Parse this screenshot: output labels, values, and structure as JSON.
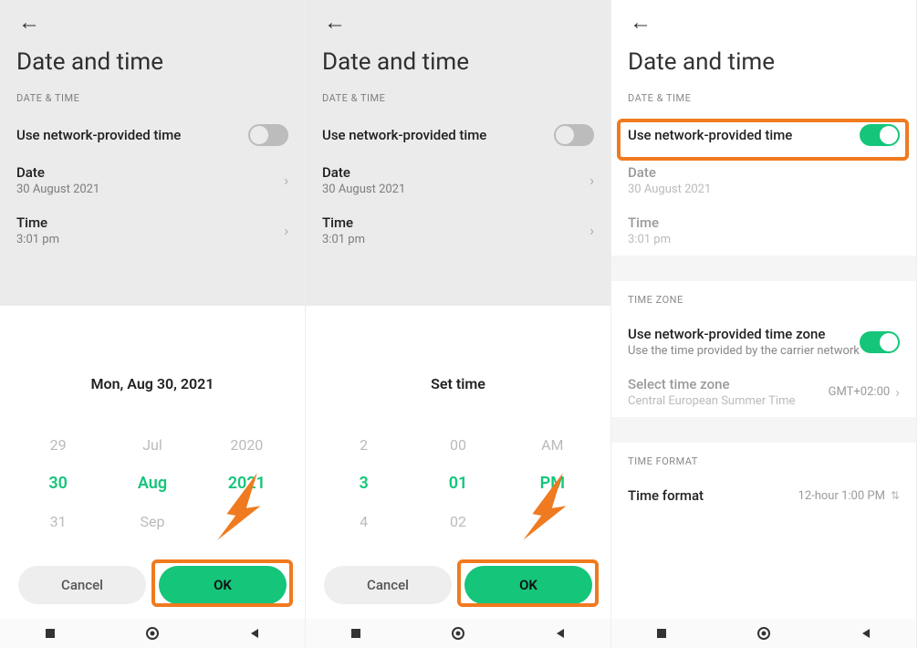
{
  "common": {
    "page_title": "Date and time",
    "section_datetime": "DATE & TIME",
    "network_time_label": "Use network-provided time",
    "date_label": "Date",
    "date_value": "30 August 2021",
    "time_label": "Time",
    "time_value": "3:01 pm",
    "cancel": "Cancel",
    "ok": "OK"
  },
  "s1": {
    "sheet_title": "Mon, Aug 30, 2021",
    "picker": {
      "prev": [
        "29",
        "Jul",
        "2020"
      ],
      "sel": [
        "30",
        "Aug",
        "2021"
      ],
      "next": [
        "31",
        "Sep",
        ""
      ]
    }
  },
  "s2": {
    "sheet_title": "Set time",
    "picker": {
      "prev": [
        "2",
        "00",
        "AM"
      ],
      "sel": [
        "3",
        "01",
        "PM"
      ],
      "next": [
        "4",
        "02",
        ""
      ]
    }
  },
  "s3": {
    "section_timezone": "TIME ZONE",
    "network_tz_label": "Use network-provided time zone",
    "network_tz_sub": "Use the time provided by the carrier network",
    "select_tz_label": "Select time zone",
    "select_tz_sub": "Central European Summer Time",
    "select_tz_value": "GMT+02:00",
    "section_timeformat": "TIME FORMAT",
    "timeformat_label": "Time format",
    "timeformat_value": "12-hour 1:00 PM"
  }
}
